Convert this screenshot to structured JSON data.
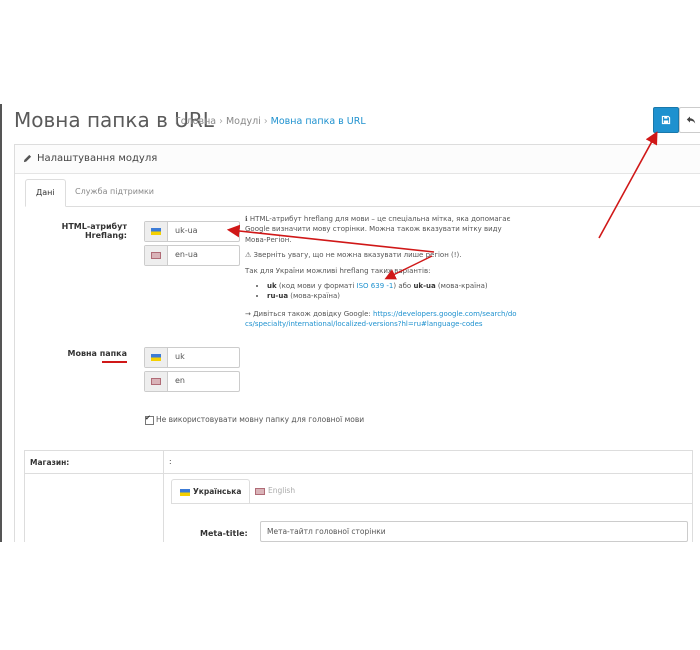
{
  "header": {
    "title": "Мовна папка в URL",
    "breadcrumb": [
      "Головна",
      "Модулі",
      "Мовна папка в URL"
    ],
    "save_icon": "save-icon",
    "back_icon": "reply-icon",
    "accent": "#1e91cf"
  },
  "panel": {
    "title": "Налаштування модуля",
    "tabs": [
      {
        "label": "Дані",
        "active": true
      },
      {
        "label": "Служба підтримки",
        "active": false
      }
    ]
  },
  "hreflang": {
    "label": "HTML-атрибут Hreflang:",
    "fields": [
      {
        "flag": "ua-flag-icon",
        "value": "uk-ua"
      },
      {
        "flag": "gb-flag-icon",
        "value": "en-ua"
      }
    ]
  },
  "help": {
    "p1_prefix": "ℹ",
    "p1": "HTML-атрибут hreflang для мови – це спеціальна мітка, яка допомагає Google визначити мову сторінки. Можна також вказувати мітку виду Мова-Регіон.",
    "p2_prefix": "⚠",
    "p2": "Зверніть увагу, що не можна вказувати лише регіон (!).",
    "p3": "Так для України можливі hreflang таких варіантів:",
    "li1_code": "uk",
    "li1_text_a": " (код мови у форматі ",
    "li1_link": "ISO 639 -1",
    "li1_text_b": ") або ",
    "li1_code2": "uk-ua",
    "li1_text_c": " (мова-країна)",
    "li2_code": "ru-ua",
    "li2_text": " (мова-країна)",
    "p4_prefix": "→ Дивіться також довідку Google: ",
    "p4_link": "https://developers.google.com/search/docs/specialty/international/localized-versions?hl=ru#language-codes"
  },
  "folder": {
    "label": "Мовна папка",
    "fields": [
      {
        "flag": "ua-flag-icon",
        "value": "uk"
      },
      {
        "flag": "gb-flag-icon",
        "value": "en"
      }
    ]
  },
  "checkbox": {
    "label": "Не використовувати мовну папку для головної мови",
    "checked": true
  },
  "store": {
    "label": "Магазин:",
    "value": ":",
    "lang_tabs": [
      {
        "label": "Українська",
        "flag": "ua-flag-icon",
        "active": true
      },
      {
        "label": "English",
        "flag": "gb-flag-icon",
        "active": false
      }
    ],
    "meta_label": "Meta-title:",
    "meta_value": "Мета-тайтл головної сторінки"
  },
  "annotation_color": "#d01818"
}
